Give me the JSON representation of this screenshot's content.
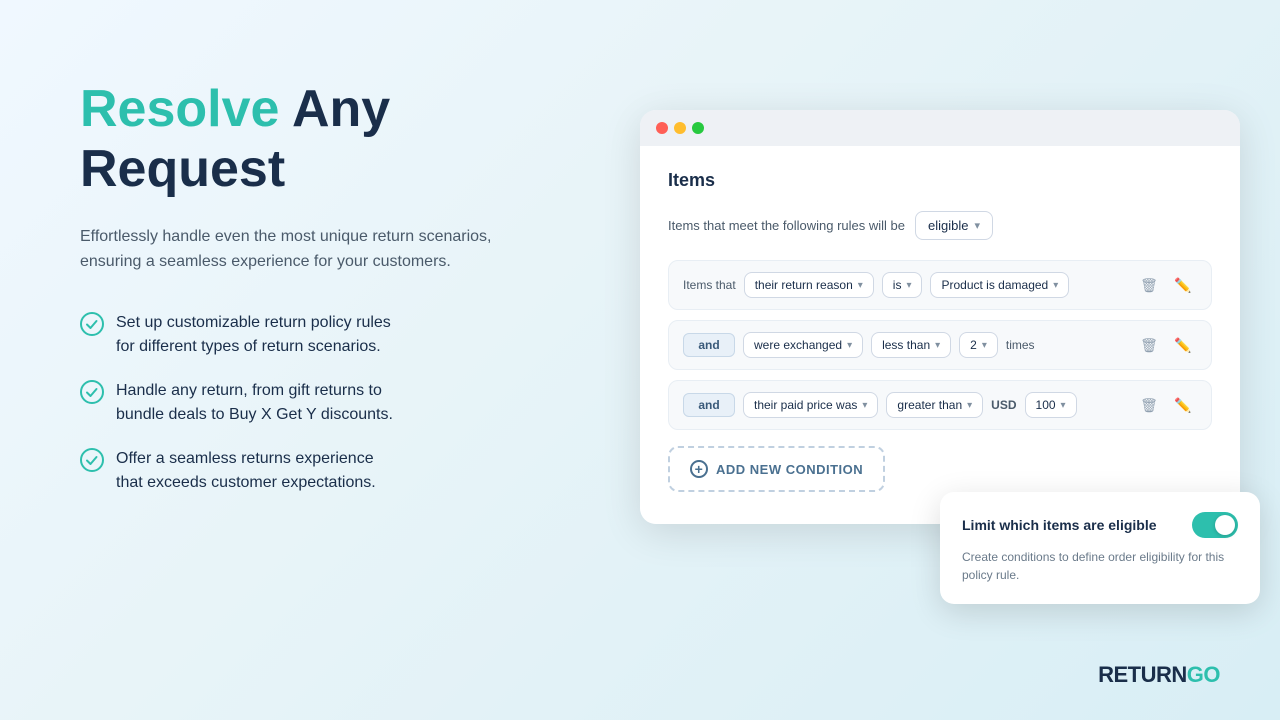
{
  "headline": {
    "resolve": "Resolve",
    "rest": " Any\nRequest"
  },
  "subtitle": "Effortlessly handle even the most unique return scenarios, ensuring a seamless experience for your customers.",
  "features": [
    {
      "id": "f1",
      "text": "Set up customizable return policy rules for different types of return scenarios."
    },
    {
      "id": "f2",
      "text": "Handle any return, from gift returns to bundle deals to Buy X Get Y discounts."
    },
    {
      "id": "f3",
      "text": "Offer a seamless returns experience that exceeds customer expectations."
    }
  ],
  "logo": {
    "return": "RETURN",
    "go": "GO"
  },
  "browser": {
    "section_title": "Items",
    "eligibility_label": "Items that meet the following rules will be",
    "eligibility_value": "eligible",
    "conditions": [
      {
        "prefix": "Items that",
        "field": "their return reason",
        "operator": "is",
        "value": "Product is damaged"
      },
      {
        "prefix": "and",
        "field": "were exchanged",
        "operator": "less than",
        "number": "2",
        "unit": "times"
      },
      {
        "prefix": "and",
        "field": "their paid price was",
        "operator": "greater than",
        "currency": "USD",
        "number": "100"
      }
    ],
    "add_condition_label": "ADD NEW CONDITION"
  },
  "tooltip": {
    "title": "Limit which items are eligible",
    "description": "Create conditions to define order eligibility for this policy rule.",
    "toggle_on": true
  }
}
